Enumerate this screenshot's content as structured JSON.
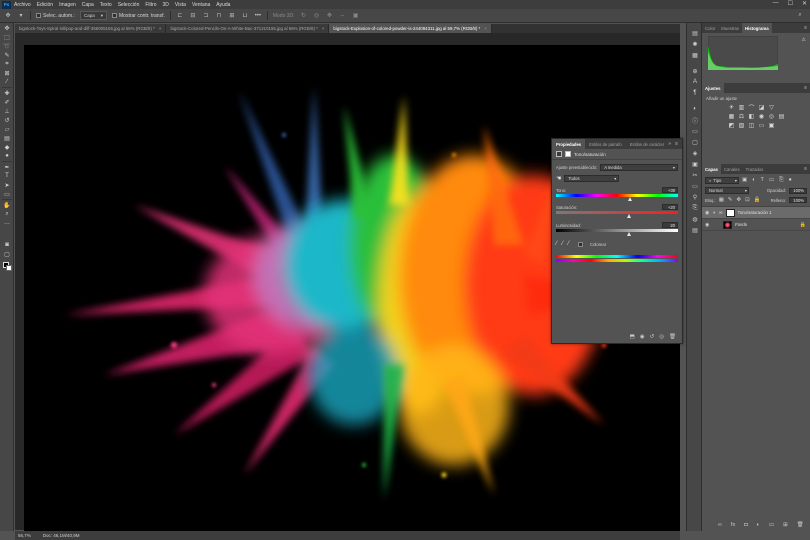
{
  "menubar": {
    "logo": "Ps",
    "items": [
      "Archivo",
      "Edición",
      "Imagen",
      "Capa",
      "Texto",
      "Selección",
      "Filtro",
      "3D",
      "Vista",
      "Ventana",
      "Ayuda"
    ],
    "window_controls": [
      "—",
      "☐",
      "✕"
    ]
  },
  "options": {
    "autoselect_label": "Selec. autom.:",
    "autoselect_target": "Capa",
    "show_transform_label": "Mostrar contr. transf.",
    "mode3d_label": "Modo 3D:"
  },
  "tabs": [
    {
      "label": "bigstock-Toys-Spiral-lollipop-and-diff-356005155.jpg al 56% (RGB/8) *",
      "active": false
    },
    {
      "label": "bigstock-Colored-Pencils-On-A-White-Bac-371210155.jpg al 56% (RGB/8) *",
      "active": false
    },
    {
      "label": "bigstock-Explosion-of-colored-powder-is-244094311.jpg al 59,7% (RGB/8) *",
      "active": true
    }
  ],
  "status": {
    "zoom": "56,7%",
    "doc": "Doc: 46,1M/40,9M"
  },
  "properties": {
    "tabs": [
      "Propiedades",
      "Estilos de párrafo",
      "Estilos de carácter"
    ],
    "header": "Tono/saturación",
    "preset_label": "Ajuste preestablecido:",
    "preset_value": "A medida",
    "channel_value": "Todos",
    "hue_label": "Tono:",
    "hue_value": "+39",
    "hue": 39,
    "saturation_label": "Saturación:",
    "saturation_value": "+20",
    "saturation": 20,
    "lightness_label": "Luminosidad:",
    "lightness_value": "20",
    "lightness": 20,
    "colorize_label": "Colorear"
  },
  "right": {
    "color_tabs": [
      "Color",
      "Muestras",
      "Histograma"
    ],
    "adjust_tab": "Ajustes",
    "adjust_hint": "Añadir un ajuste",
    "layer_tabs": [
      "Capas",
      "Canales",
      "Trazados"
    ],
    "kind_label": "Tipo",
    "blend_mode": "Normal",
    "opacity_label": "Opacidad:",
    "opacity_value": "100%",
    "lock_label": "Bloq.:",
    "fill_label": "Relleno:",
    "fill_value": "100%",
    "layers": [
      {
        "name": "Tono/saturación 1",
        "selected": true
      },
      {
        "name": "Fondo",
        "selected": false
      }
    ]
  },
  "colors": {
    "ui_dark": "#3d3d3d",
    "ui_panel": "#535353",
    "accent_blue": "#31a8ff"
  }
}
